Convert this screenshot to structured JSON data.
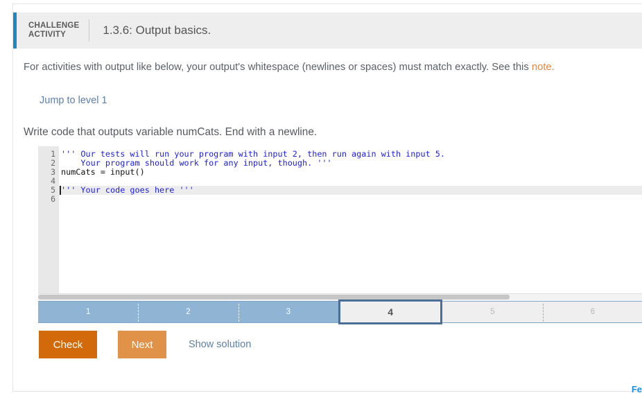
{
  "header": {
    "kicker_line1": "CHALLENGE",
    "kicker_line2": "ACTIVITY",
    "title": "1.3.6: Output basics.",
    "accent_color": "#1f87c4"
  },
  "intro": {
    "text_before_link": "For activities with output like below, your output's whitespace (newlines or spaces) must match exactly. See this ",
    "link_text": "note.",
    "link_color": "#e8873c"
  },
  "jump_to_level": {
    "label": "Jump to level 1"
  },
  "prompt": {
    "text": "Write code that outputs variable numCats. End with a newline."
  },
  "editor": {
    "line_numbers": [
      "1",
      "2",
      "3",
      "4",
      "5",
      "6"
    ],
    "active_line": 5,
    "lines": [
      {
        "n": 1,
        "segments": [
          {
            "text": "''' Our tests will run your program with input 2, then run again with input 5.",
            "kind": "string"
          }
        ]
      },
      {
        "n": 2,
        "segments": [
          {
            "text": "    Your program should work for any input, though. '''",
            "kind": "string"
          }
        ]
      },
      {
        "n": 3,
        "segments": [
          {
            "text": "numCats = input()",
            "kind": "plain"
          }
        ]
      },
      {
        "n": 4,
        "segments": [
          {
            "text": "",
            "kind": "plain"
          }
        ]
      },
      {
        "n": 5,
        "segments": [
          {
            "text": "''' Your code goes here '''",
            "kind": "string"
          }
        ]
      },
      {
        "n": 6,
        "segments": [
          {
            "text": "",
            "kind": "plain"
          }
        ]
      }
    ],
    "string_color": "#2020dd",
    "plain_color": "#101010"
  },
  "levels": {
    "items": [
      {
        "label": "1",
        "state": "done"
      },
      {
        "label": "2",
        "state": "done"
      },
      {
        "label": "3",
        "state": "done"
      },
      {
        "label": "4",
        "state": "current"
      },
      {
        "label": "5",
        "state": "todo"
      },
      {
        "label": "6",
        "state": "todo"
      }
    ],
    "done_color": "#8fb4d4",
    "current_border_color": "#4a6e96"
  },
  "buttons": {
    "check_label": "Check",
    "check_color": "#d2690a",
    "next_label": "Next",
    "next_color": "#df9248",
    "show_solution_label": "Show solution"
  },
  "footer": {
    "feedback_label": "Fe"
  }
}
